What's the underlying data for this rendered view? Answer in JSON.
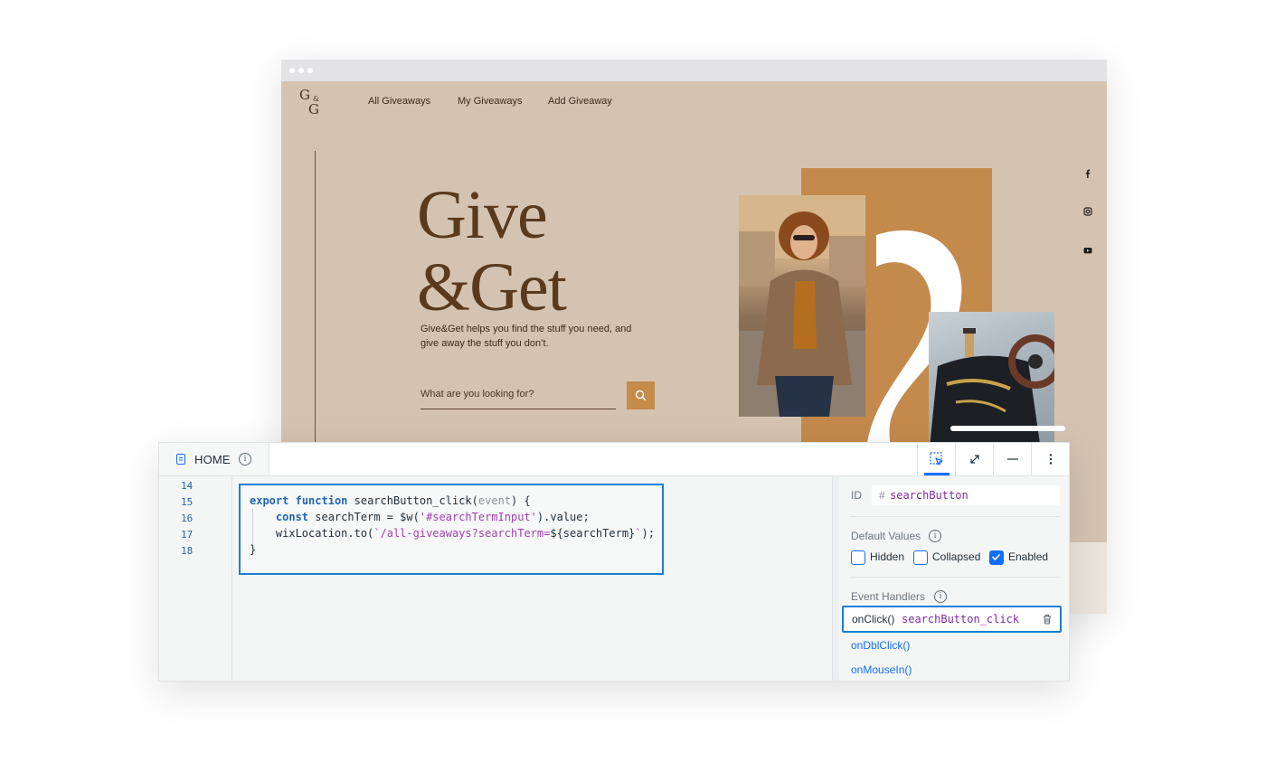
{
  "site": {
    "logo": {
      "g1": "G",
      "amp": "&",
      "g2": "G"
    },
    "nav": [
      "All Giveaways",
      "My Giveaways",
      "Add Giveaway"
    ],
    "hero_line1": "Give",
    "hero_line2": "&Get",
    "hero_sub": "Give&Get helps you find the stuff you need, and give away the stuff you don’t.",
    "search_placeholder": "What are you looking for?",
    "social": [
      "facebook-icon",
      "instagram-icon",
      "youtube-icon"
    ],
    "colors": {
      "background": "#d4c3b1",
      "accent": "#c38a4c",
      "text": "#5a3a1d"
    }
  },
  "editor": {
    "page_name": "HOME",
    "line_numbers": [
      "14",
      "15",
      "16",
      "17",
      "18"
    ],
    "code": {
      "l1_export": "export",
      "l1_function": "function",
      "l1_name": " searchButton_click(",
      "l1_param": "event",
      "l1_end": ") {",
      "l2_const": "const",
      "l2_pre": " searchTerm = $w(",
      "l2_str": "'#searchTermInput'",
      "l2_end": ").value;",
      "l3_pre": "wixLocation.to(",
      "l3_str": "`/all-giveaways?searchTerm=",
      "l3_interp": "${searchTerm}",
      "l3_str_end": "`",
      "l3_end": ");",
      "l4": "}"
    },
    "toolbar": [
      "select-element-icon",
      "expand-icon",
      "minimize-icon",
      "more-options-icon"
    ]
  },
  "properties": {
    "id_label": "ID",
    "id_hash": "#",
    "id_value": "searchButton",
    "default_values_label": "Default Values",
    "checkboxes": [
      {
        "label": "Hidden",
        "checked": false
      },
      {
        "label": "Collapsed",
        "checked": false
      },
      {
        "label": "Enabled",
        "checked": true
      }
    ],
    "event_handlers_label": "Event Handlers",
    "active_handler": {
      "event": "onClick()",
      "function": "searchButton_click"
    },
    "other_handlers": [
      "onDblClick()",
      "onMouseIn()"
    ],
    "colors": {
      "highlight": "#1a7fd6",
      "function_text": "#7b2aa3",
      "link": "#116dff"
    }
  }
}
